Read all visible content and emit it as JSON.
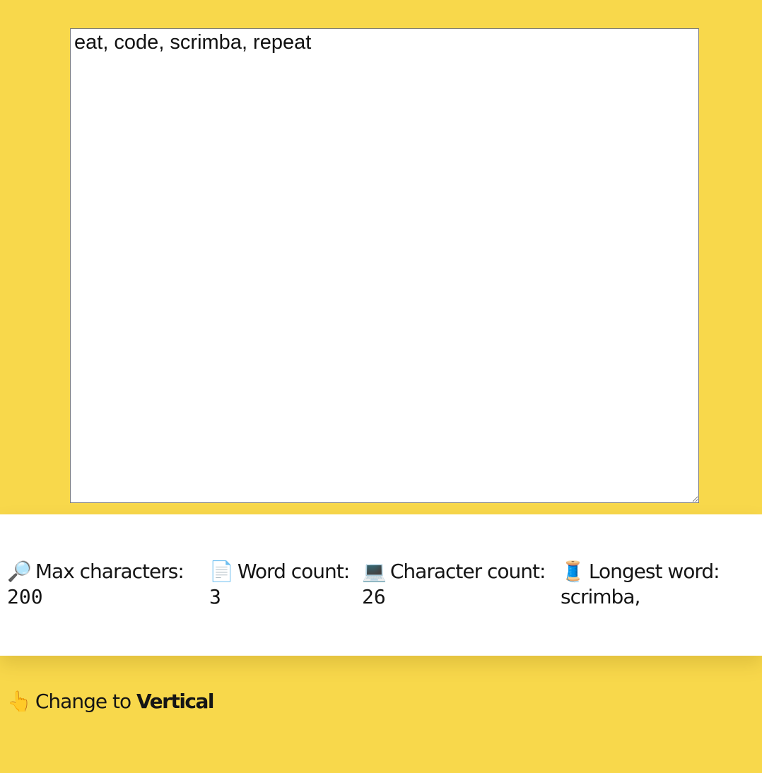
{
  "editor": {
    "text": "eat, code, scrimba, repeat"
  },
  "stats": {
    "max_characters": {
      "icon": "magnifying-glass-icon",
      "glyph": "🔎",
      "label": "Max characters:",
      "value": "200"
    },
    "word_count": {
      "icon": "document-icon",
      "glyph": "📄",
      "label": "Word count:",
      "value": "3"
    },
    "character_count": {
      "icon": "laptop-icon",
      "glyph": "💻",
      "label": "Character count:",
      "value": "26"
    },
    "longest_word": {
      "icon": "thread-spool-icon",
      "glyph": "🧵",
      "label": "Longest word:",
      "value": "scrimba,"
    }
  },
  "toggle": {
    "icon": "pointing-up-hand-icon",
    "glyph": "👆",
    "prefix": "Change to",
    "target": "Vertical"
  },
  "colors": {
    "background": "#f8d84b",
    "panel": "#ffffff"
  }
}
